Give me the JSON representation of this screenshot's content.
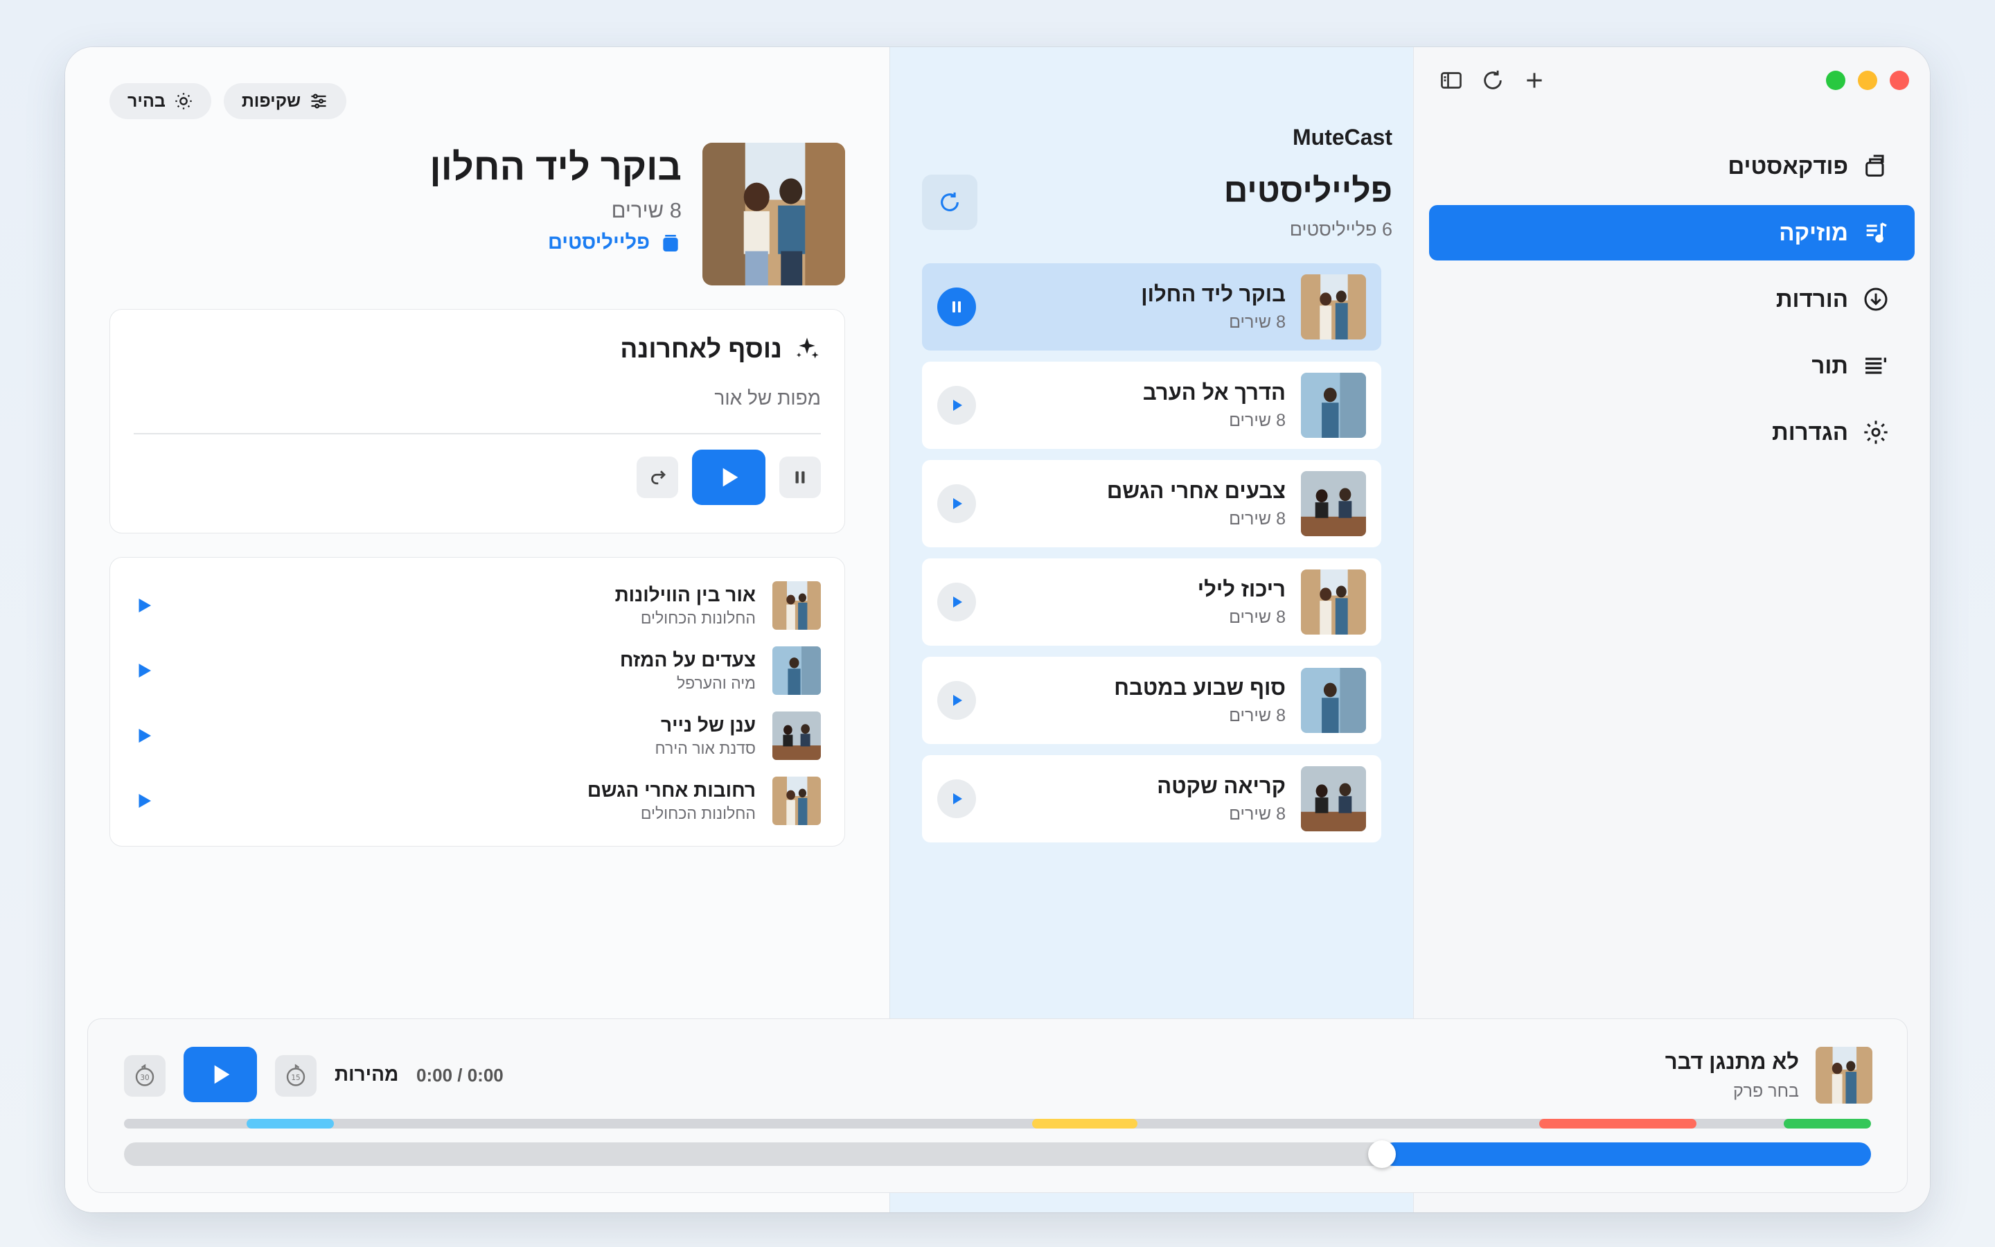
{
  "app": {
    "brand": "MuteCast"
  },
  "sidebar": {
    "items": [
      {
        "label": "פודקאסטים",
        "icon": "podcast-icon",
        "active": false
      },
      {
        "label": "מוזיקה",
        "icon": "music-note-icon",
        "active": true
      },
      {
        "label": "הורדות",
        "icon": "download-icon",
        "active": false
      },
      {
        "label": "תור",
        "icon": "queue-list-icon",
        "active": false
      },
      {
        "label": "הגדרות",
        "icon": "gear-icon",
        "active": false
      }
    ]
  },
  "playlists": {
    "title": "פלייליסטים",
    "count_label": "6 פלייליסטים",
    "items": [
      {
        "name": "בוקר ליד החלון",
        "sub": "8 שירים",
        "playing": true
      },
      {
        "name": "הדרך אל הערב",
        "sub": "8 שירים",
        "playing": false
      },
      {
        "name": "צבעים אחרי הגשם",
        "sub": "8 שירים",
        "playing": false
      },
      {
        "name": "ריכוז לילי",
        "sub": "8 שירים",
        "playing": false
      },
      {
        "name": "סוף שבוע במטבח",
        "sub": "8 שירים",
        "playing": false
      },
      {
        "name": "קריאה שקטה",
        "sub": "8 שירים",
        "playing": false
      }
    ]
  },
  "detail": {
    "chips": {
      "theme": "בהיר",
      "transparency": "שקיפות"
    },
    "title": "בוקר ליד החלון",
    "sub": "8 שירים",
    "link": "פלייליסטים",
    "recent": {
      "title": "נוסף לאחרונה",
      "track": "מפות של אור"
    },
    "songs": [
      {
        "name": "אור בין הווילונות",
        "artist": "החלונות הכחולים"
      },
      {
        "name": "צעדים על המזח",
        "artist": "מיה והערפל"
      },
      {
        "name": "ענן של נייר",
        "artist": "סדנת אור הירח"
      },
      {
        "name": "רחובות אחרי הגשם",
        "artist": "החלונות הכחולים"
      }
    ]
  },
  "player": {
    "title": "לא מתנגן דבר",
    "sub": "בחר פרק",
    "speed_label": "מהירות",
    "time": "0:00 / 0:00",
    "back_seconds": "30",
    "fwd_seconds": "15",
    "progress_fraction": 0.28,
    "chapter_colors": {
      "cyan": "#5ac8fa",
      "yellow": "#ffd24a",
      "red": "#ff6b5b",
      "green": "#34c759"
    }
  },
  "colors": {
    "accent": "#1a7cf2"
  }
}
